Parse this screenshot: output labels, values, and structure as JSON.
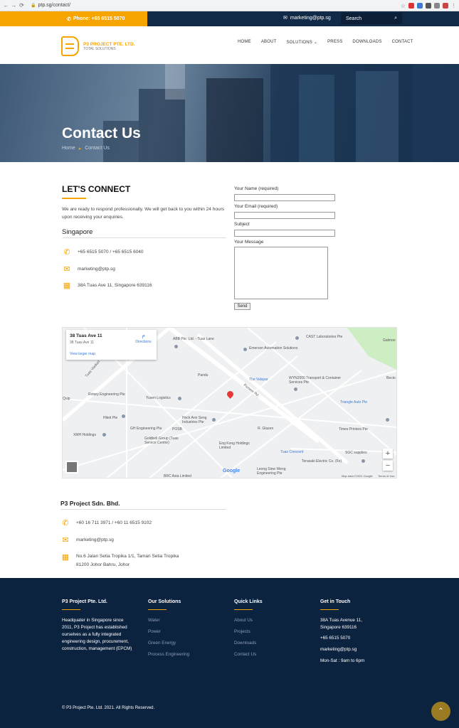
{
  "browser": {
    "url": "ptp.sg/contact/"
  },
  "topbar": {
    "phone": "Phone: +65 6515 5070",
    "email": "marketing@ptp.sg",
    "search_label": "Search"
  },
  "logo": {
    "name": "P3 PROJECT PTE. LTD.",
    "tagline": "TOTAL SOLUTIONS"
  },
  "nav": {
    "items": [
      "HOME",
      "ABOUT",
      "SOLUTIONS",
      "PRESS",
      "DOWNLOADS",
      "CONTACT"
    ]
  },
  "hero": {
    "title": "Contact Us",
    "breadcrumb_home": "Home",
    "breadcrumb_current": "Contact Us"
  },
  "connect": {
    "title": "LET'S CONNECT",
    "description": "We are ready to respond professionally. We will get back to you within 24 hours upon receiving your enquiries.",
    "region": "Singapore",
    "phone": "+65 6515 5070 / +65 6515 6040",
    "email": "marketing@ptp.sg",
    "address": "38A Tuas Ave 11, Singapore 639116"
  },
  "form": {
    "name_label": "Your Name (required)",
    "email_label": "Your Email (required)",
    "subject_label": "Subject",
    "message_label": "Your Message",
    "send_label": "Send"
  },
  "map": {
    "info_title": "38 Tuas Ave 11",
    "info_sub": "38 Tuas Ave 11",
    "directions": "Directions",
    "larger_map": "View larger map",
    "labels": [
      "ABB Pte. Ltd. - Tuas Lane",
      "CAST Laboratories Pte",
      "Galmon",
      "Emerson Automation Solutions",
      "The Valspar",
      "WYN2000 Transport & Container Services Pte",
      "Becto",
      "Pandu",
      "Rotary Engineering Pte",
      "Yusen Logistics",
      "Triangle Auto Pte",
      "Quip",
      "Hiteit Pte",
      "Hock Ann Seng Industries Pte",
      "R. Glazen",
      "Times Printers Pte",
      "XMH Holdings",
      "GH Engineering Pte",
      "POSB",
      "Goldbell Group (Tuas Service Centre)",
      "Eng Kong Holdings Limited",
      "Tuas Crescent",
      "SGC supplies",
      "Terasaki Electric Co. (Fe)",
      "Leong Siew Weng Engineering Pte",
      "BRC Asia Limited",
      "Tuas Viaduct",
      "Pioneer Rd",
      "Map data ©2021 Google",
      "Terms of Use",
      "Google"
    ]
  },
  "malaysia": {
    "title": "P3 Project Sdn. Bhd.",
    "phone": "+60 16 711 3971 / +60 11 6515 9102",
    "email": "marketing@ptp.sg",
    "address_line1": "No.6 Jalan Setia Tropika 1/1, Taman Setia Tropika",
    "address_line2": "81200 Johor Bahru, Johor"
  },
  "footer": {
    "col1_title": "P3 Project Pte. Ltd.",
    "col1_text": "Headquater in Singapore since 2011, P3 Project has established ourselves as a fully integrated engineering design, procurement, construction, management (EPCM)",
    "col2_title": "Our Solutions",
    "col2_links": [
      "Water",
      "Power",
      "Green Energy",
      "Process Engineering"
    ],
    "col3_title": "Quick Links",
    "col3_links": [
      "About Us",
      "Projects",
      "Downloads",
      "Contact Us"
    ],
    "col4_title": "Get in Touch",
    "col4_address": "38A Tuas Avenue 11, Singapore 639116",
    "col4_phone": "+65 6515 5070",
    "col4_email": "marketing@ptp.sg",
    "col4_hours": "Mon-Sat : 9am to 6pm",
    "copyright": "© P3 Project Pte. Ltd. 2021. All Rights Reserved."
  },
  "colors": {
    "accent": "#f5a400",
    "navy": "#0c2340",
    "topbar": "#112a47"
  }
}
